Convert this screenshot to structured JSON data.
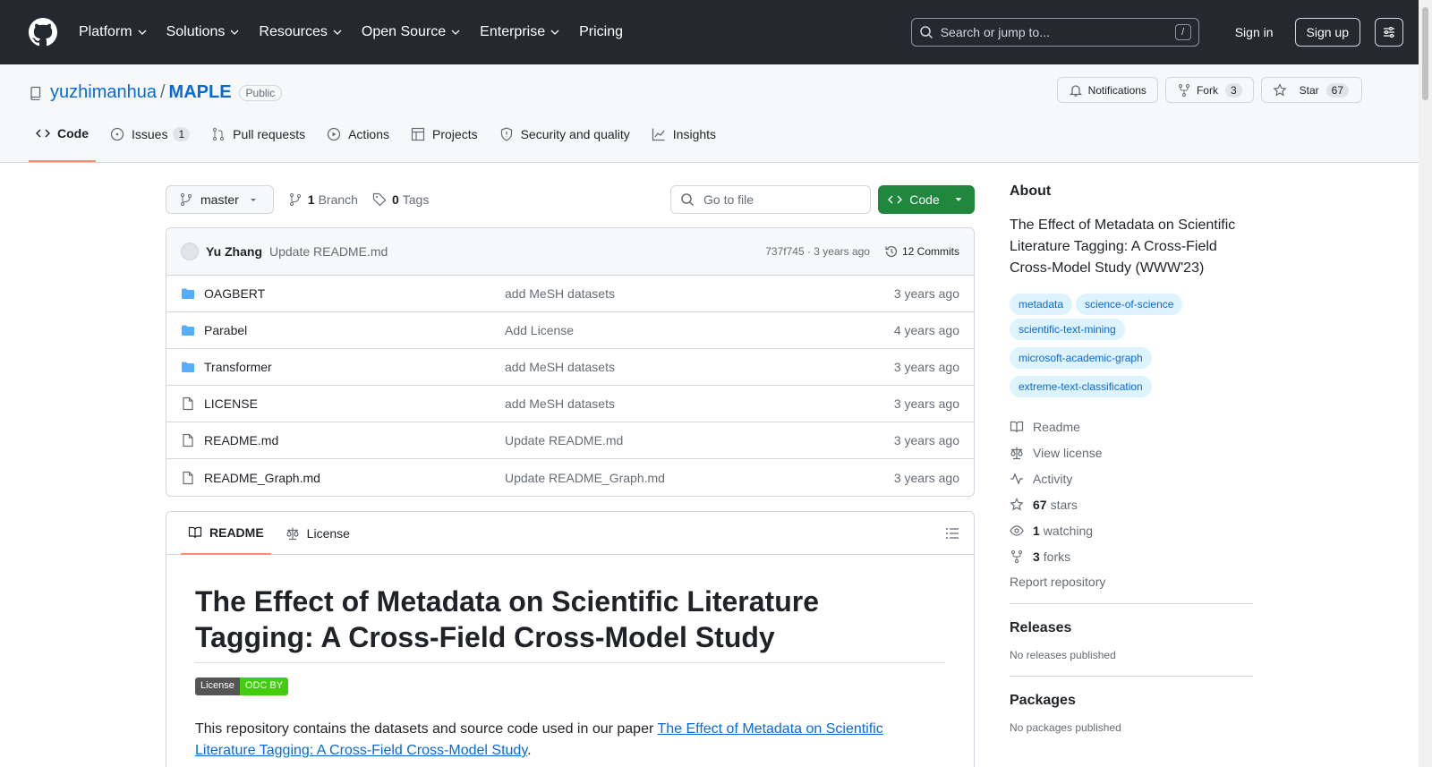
{
  "header": {
    "nav": [
      "Platform",
      "Solutions",
      "Resources",
      "Open Source",
      "Enterprise",
      "Pricing"
    ],
    "search_placeholder": "Search or jump to...",
    "search_shortcut": "/",
    "sign_in": "Sign in",
    "sign_up": "Sign up"
  },
  "repo": {
    "owner": "yuzhimanhua",
    "separator": "/",
    "name": "MAPLE",
    "visibility": "Public",
    "notifications_label": "Notifications",
    "fork_label": "Fork",
    "fork_count": "3",
    "star_label": "Star",
    "star_count": "67"
  },
  "tabs": [
    {
      "label": "Code",
      "icon": "code-icon"
    },
    {
      "label": "Issues",
      "icon": "issue-icon",
      "count": "1"
    },
    {
      "label": "Pull requests",
      "icon": "pull-request-icon"
    },
    {
      "label": "Actions",
      "icon": "play-icon"
    },
    {
      "label": "Projects",
      "icon": "table-icon"
    },
    {
      "label": "Security and quality",
      "icon": "shield-icon"
    },
    {
      "label": "Insights",
      "icon": "graph-icon"
    }
  ],
  "toolbar": {
    "branch": "master",
    "branch_count": "1",
    "branch_label": "Branch",
    "tag_count": "0",
    "tag_label": "Tags",
    "goto_placeholder": "Go to file",
    "code_button": "Code"
  },
  "latest_commit": {
    "author": "Yu Zhang",
    "message": "Update README.md",
    "hash_time": "737f745 · 3 years ago",
    "commits_label": "12 Commits"
  },
  "files": [
    {
      "name": "OAGBERT",
      "type": "folder",
      "commit": "add MeSH datasets",
      "time": "3 years ago"
    },
    {
      "name": "Parabel",
      "type": "folder",
      "commit": "Add License",
      "time": "4 years ago"
    },
    {
      "name": "Transformer",
      "type": "folder",
      "commit": "add MeSH datasets",
      "time": "3 years ago"
    },
    {
      "name": "LICENSE",
      "type": "file",
      "commit": "add MeSH datasets",
      "time": "3 years ago"
    },
    {
      "name": "README.md",
      "type": "file",
      "commit": "Update README.md",
      "time": "3 years ago"
    },
    {
      "name": "README_Graph.md",
      "type": "file",
      "commit": "Update README_Graph.md",
      "time": "3 years ago"
    }
  ],
  "readme": {
    "tab_readme": "README",
    "tab_license": "License",
    "title": "The Effect of Metadata on Scientific Literature Tagging: A Cross-Field Cross-Model Study",
    "badge_left": "License",
    "badge_right": "ODC BY",
    "para_prefix": "This repository contains the datasets and source code used in our paper ",
    "para_link": "The Effect of Metadata on Scientific Literature Tagging: A Cross-Field Cross-Model Study",
    "para_suffix": "."
  },
  "sidebar": {
    "about_title": "About",
    "description": "The Effect of Metadata on Scientific Literature Tagging: A Cross-Field Cross-Model Study (WWW'23)",
    "topics": [
      "metadata",
      "science-of-science",
      "scientific-text-mining",
      "microsoft-academic-graph",
      "extreme-text-classification"
    ],
    "readme": "Readme",
    "license": "View license",
    "activity": "Activity",
    "stars_count": "67",
    "stars_label": "stars",
    "watching_count": "1",
    "watching_label": "watching",
    "forks_count": "3",
    "forks_label": "forks",
    "report": "Report repository",
    "releases_title": "Releases",
    "releases_note": "No releases published",
    "packages_title": "Packages",
    "packages_note": "No packages published"
  }
}
